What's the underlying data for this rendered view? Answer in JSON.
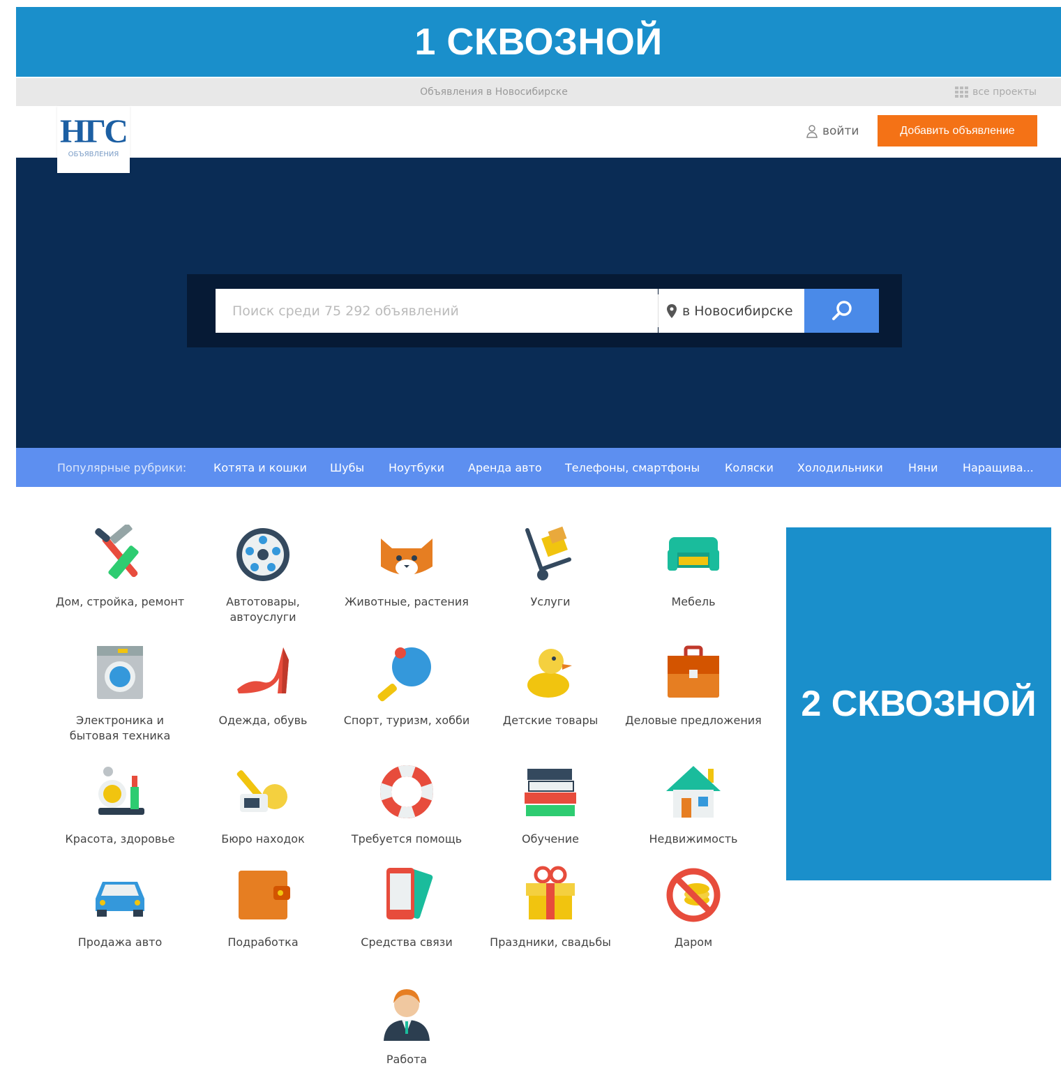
{
  "banners": {
    "top": "1 СКВОЗНОЙ",
    "side": "2 СКВОЗНОЙ"
  },
  "topbar": {
    "center": "Объявления в Новосибирске",
    "projects": "все проекты"
  },
  "logo": {
    "mark": "НГС",
    "sub": "ОБЪЯВЛЕНИЯ"
  },
  "header": {
    "login": "войти",
    "add_button": "Добавить объявление"
  },
  "search": {
    "placeholder": "Поиск среди  75 292  объявлений",
    "location": "в Новосибирске"
  },
  "popular": {
    "label": "Популярные рубрики:",
    "items": [
      "Котята и кошки",
      "Шубы",
      "Ноутбуки",
      "Аренда авто",
      "Телефоны, смартфоны",
      "Коляски",
      "Холодильники",
      "Няни",
      "Наращива..."
    ]
  },
  "categories": [
    {
      "label": "Дом, стройка, ремонт",
      "icon": "tools-icon"
    },
    {
      "label": "Автотовары, автоуслуги",
      "icon": "wheel-icon"
    },
    {
      "label": "Животные, растения",
      "icon": "cat-icon"
    },
    {
      "label": "Услуги",
      "icon": "delivery-cart-icon"
    },
    {
      "label": "Мебель",
      "icon": "sofa-icon"
    },
    {
      "label": "Электроника и бытовая техника",
      "icon": "washing-machine-icon"
    },
    {
      "label": "Одежда, обувь",
      "icon": "high-heel-icon"
    },
    {
      "label": "Спорт, туризм, хобби",
      "icon": "ping-pong-icon"
    },
    {
      "label": "Детские товары",
      "icon": "duck-icon"
    },
    {
      "label": "Деловые предложения",
      "icon": "briefcase-icon"
    },
    {
      "label": "Красота, здоровье",
      "icon": "cosmetics-icon"
    },
    {
      "label": "Бюро находок",
      "icon": "keys-icon"
    },
    {
      "label": "Требуется помощь",
      "icon": "lifebuoy-icon"
    },
    {
      "label": "Обучение",
      "icon": "books-icon"
    },
    {
      "label": "Недвижимость",
      "icon": "house-icon"
    },
    {
      "label": "Продажа авто",
      "icon": "car-icon"
    },
    {
      "label": "Подработка",
      "icon": "wallet-icon"
    },
    {
      "label": "Средства связи",
      "icon": "phone-icon"
    },
    {
      "label": "Праздники, свадьбы",
      "icon": "gift-icon"
    },
    {
      "label": "Даром",
      "icon": "no-coins-icon"
    },
    {
      "label": "Работа",
      "icon": "worker-icon"
    }
  ],
  "colors": {
    "accent": "#f47216",
    "brand": "#1a8fcb",
    "hero": "#0a2c55",
    "popbar": "#5d8ff0",
    "search_button": "#4a8ae8"
  }
}
